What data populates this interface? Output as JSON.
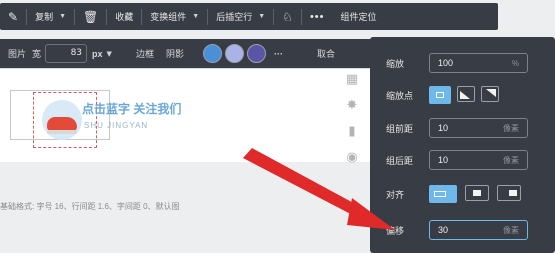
{
  "toolbar": {
    "items": [
      {
        "label": "",
        "icon": "pin-icon"
      },
      {
        "label": "复制",
        "has_caret": true
      },
      {
        "label": "",
        "icon": "trash-icon"
      },
      {
        "label": "收藏"
      },
      {
        "label": "变换组件",
        "has_caret": true
      },
      {
        "label": "后插空行",
        "has_caret": true
      },
      {
        "label": "",
        "icon": "format-brush-icon"
      },
      {
        "label": "•••"
      },
      {
        "label": "组件定位"
      }
    ]
  },
  "toolbar2": {
    "picture_label": "图片",
    "width_label": "宽",
    "width_value": "83",
    "unit": "px",
    "border_label": "边框",
    "shadow_label": "阴影",
    "more": "···",
    "cancel_partial": "取合",
    "swatches": [
      "#4a90d9",
      "#a9b3e6",
      "#5b55a8"
    ]
  },
  "canvas": {
    "banner_text": "点击蓝字 关注我们",
    "banner_sub": "SHU JINGYAN",
    "base_style": "基础格式: 字号 16、行间距 1.6、字间距 0、默认图"
  },
  "panel": {
    "scale": {
      "label": "缩放",
      "value": "100",
      "unit": "%"
    },
    "anchor": {
      "label": "缩放点"
    },
    "top_gap": {
      "label": "组前距",
      "value": "10",
      "unit": "像素"
    },
    "bottom_gap": {
      "label": "组后距",
      "value": "10",
      "unit": "像素"
    },
    "align": {
      "label": "对齐"
    },
    "offset": {
      "label": "偏移",
      "value": "30",
      "unit": "像素"
    }
  },
  "colors": {
    "dark_panel": "#383c44",
    "accent": "#6fb9ea",
    "arrow": "#e02a2a"
  }
}
